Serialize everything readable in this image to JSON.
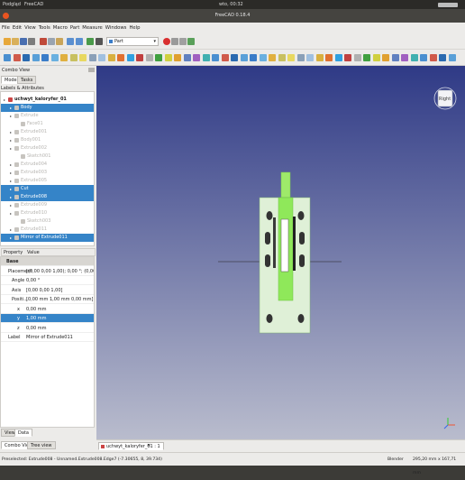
{
  "system_bar": {
    "activities": "Podgląd",
    "app": "FreeCAD",
    "clock": "wto, 00:32"
  },
  "window": {
    "title": "FreeCAD 0.18.4"
  },
  "menu": [
    "File",
    "Edit",
    "View",
    "Tools",
    "Macro",
    "Part",
    "Measure",
    "Windows",
    "Help"
  ],
  "workbench": {
    "selected": "Part"
  },
  "combo_view": {
    "title": "Combo View",
    "tabs": [
      "Model",
      "Tasks"
    ],
    "section_label": "Labels & Attributes"
  },
  "tree": [
    {
      "label": "uchwyt_kaloryfer_01",
      "level": 0,
      "state": "doc"
    },
    {
      "label": "Body",
      "level": 1,
      "state": "selected"
    },
    {
      "label": "Extrude",
      "level": 1,
      "state": "dim"
    },
    {
      "label": "Face01",
      "level": 2,
      "state": "dim"
    },
    {
      "label": "Extrude001",
      "level": 1,
      "state": "dim"
    },
    {
      "label": "Body001",
      "level": 1,
      "state": "dim"
    },
    {
      "label": "Extrude002",
      "level": 1,
      "state": "dim"
    },
    {
      "label": "Sketch001",
      "level": 2,
      "state": "dim"
    },
    {
      "label": "Extrude004",
      "level": 1,
      "state": "dim"
    },
    {
      "label": "Extrude003",
      "level": 1,
      "state": "dim"
    },
    {
      "label": "Extrude005",
      "level": 1,
      "state": "dim"
    },
    {
      "label": "Cut",
      "level": 1,
      "state": "selected"
    },
    {
      "label": "Extrude008",
      "level": 1,
      "state": "selected"
    },
    {
      "label": "Extrude009",
      "level": 1,
      "state": "dim"
    },
    {
      "label": "Extrude010",
      "level": 1,
      "state": "dim"
    },
    {
      "label": "Sketch003",
      "level": 2,
      "state": "dim"
    },
    {
      "label": "Extrude011",
      "level": 1,
      "state": "dim"
    },
    {
      "label": "Mirror of Extrude011",
      "level": 1,
      "state": "selected"
    }
  ],
  "property_header": {
    "property": "Property",
    "value": "Value"
  },
  "properties": [
    {
      "key": "Base",
      "value": "",
      "kind": "group"
    },
    {
      "key": "Placement",
      "value": "[(0,00 0,00 1,00); 0,00 °; (0,00 mm  1,00 ...",
      "kind": "row"
    },
    {
      "key": "Angle",
      "value": "0,00 °",
      "kind": "sub"
    },
    {
      "key": "Axis",
      "value": "[0,00 0,00 1,00]",
      "kind": "sub"
    },
    {
      "key": "Positi...",
      "value": "[0,00 mm  1,00 mm  0,00 mm]",
      "kind": "sub"
    },
    {
      "key": "x",
      "value": "0,00 mm",
      "kind": "subsub"
    },
    {
      "key": "y",
      "value": "1,00 mm",
      "kind": "subsub-sel"
    },
    {
      "key": "z",
      "value": "0,00 mm",
      "kind": "subsub"
    },
    {
      "key": "Label",
      "value": "Mirror of Extrude011",
      "kind": "row"
    }
  ],
  "prop_tabs": [
    "View",
    "Data"
  ],
  "bottom_tabs": [
    "Combo View",
    "Tree view"
  ],
  "doc_tab": "uchwyt_kaloryfer_01 : 1",
  "navcube": {
    "face": "Right"
  },
  "status": {
    "text": "Preselected: Extrude008 - Unnamed.Extrude008.Edge7 (-7.30655, 8, 39.734)",
    "nav": "Blender",
    "dims": "295,20 mm x 167,71 mm"
  }
}
